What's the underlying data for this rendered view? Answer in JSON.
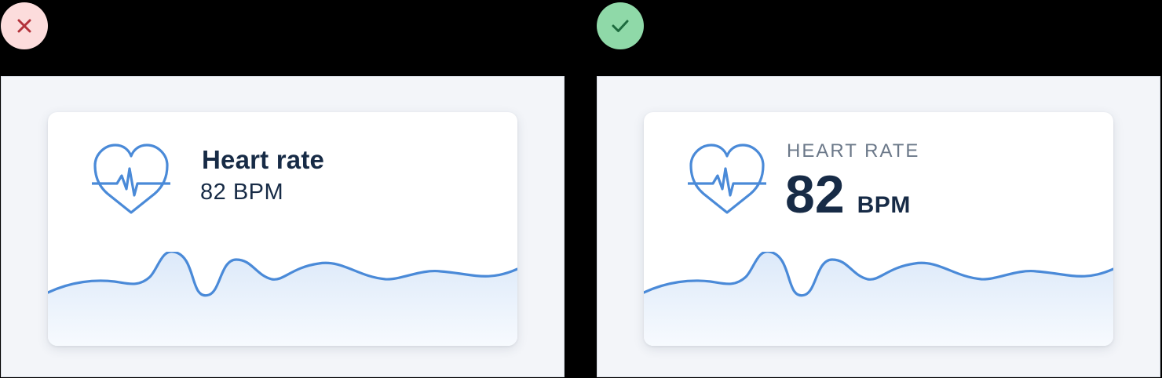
{
  "examples": [
    {
      "verdict": "incorrect",
      "icon": "close-icon",
      "title": "Heart rate",
      "value_text": "82 BPM"
    },
    {
      "verdict": "correct",
      "icon": "check-icon",
      "label": "HEART RATE",
      "value_number": "82",
      "value_unit": "BPM"
    }
  ],
  "icons": {
    "metric": "heart-rate-icon"
  },
  "colors": {
    "accent": "#4a8ad8",
    "text_dark": "#172b46",
    "text_muted": "#6b7889",
    "bad_badge_bg": "#fcdcdc",
    "bad_badge_mark": "#b3323a",
    "good_badge_bg": "#8fd9a8",
    "good_badge_mark": "#1d6b3e"
  }
}
